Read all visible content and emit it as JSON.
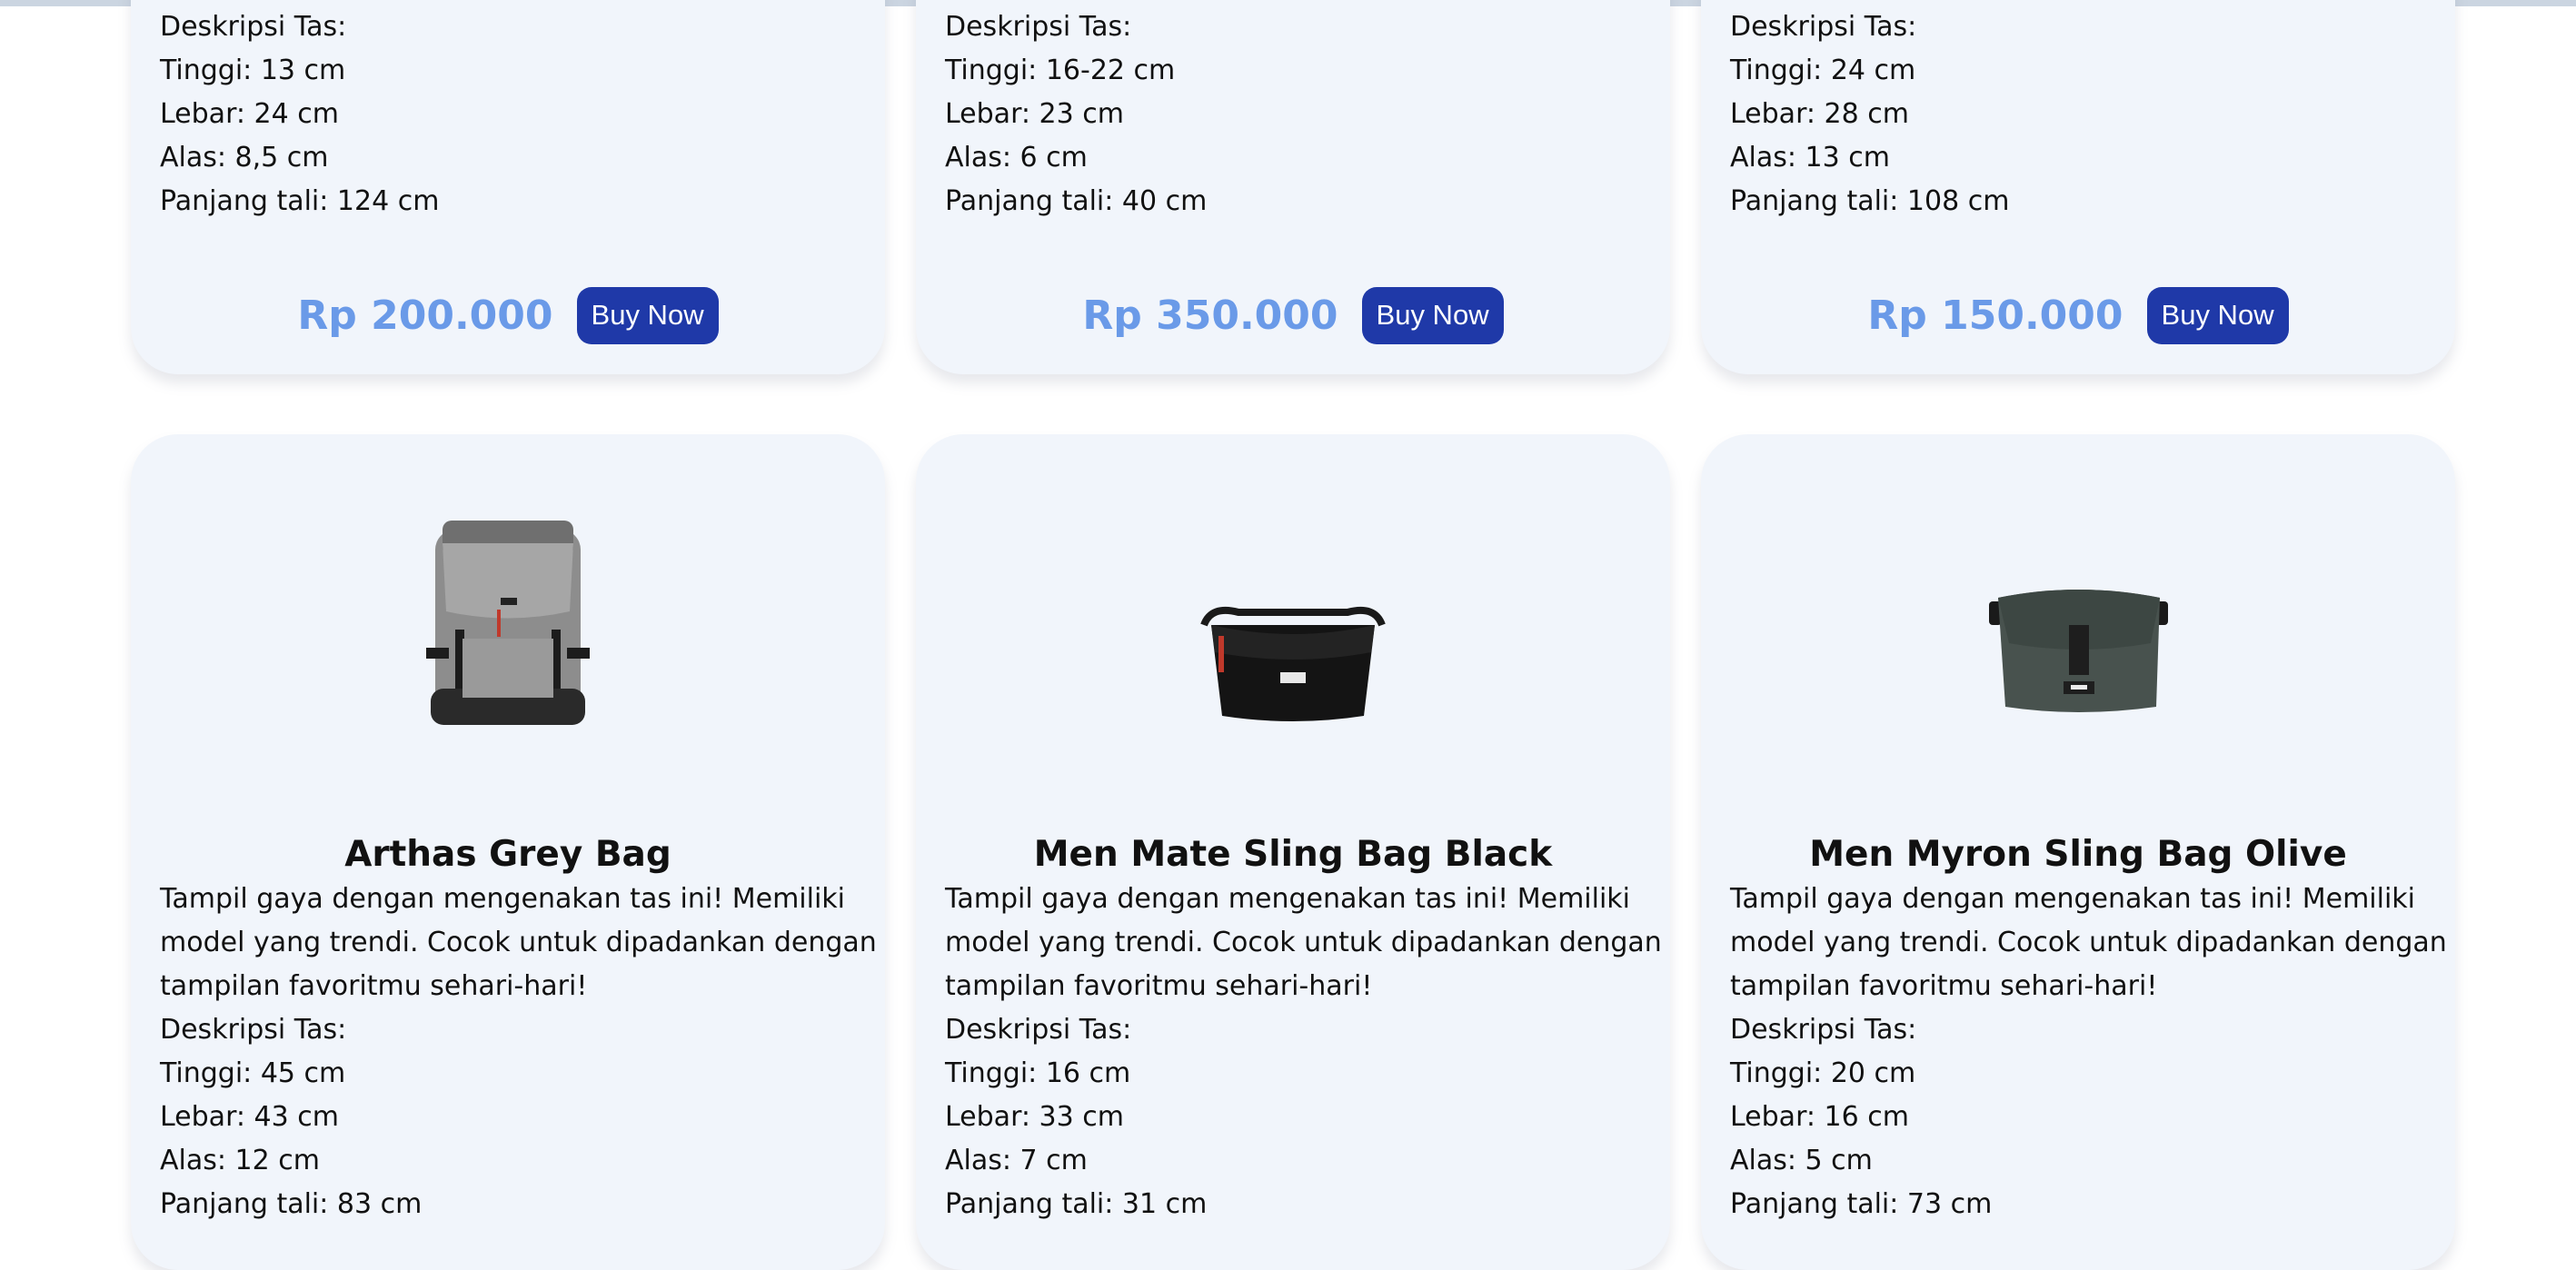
{
  "top_cards": [
    {
      "lines": [
        "Deskripsi Tas:",
        "Tinggi: 13 cm",
        "Lebar: 24 cm",
        "Alas: 8,5 cm",
        "Panjang tali: 124 cm"
      ],
      "price": "Rp 200.000",
      "button": "Buy Now"
    },
    {
      "lines": [
        "Deskripsi Tas:",
        "Tinggi: 16-22 cm",
        "Lebar: 23 cm",
        "Alas: 6 cm",
        "Panjang tali: 40 cm"
      ],
      "price": "Rp 350.000",
      "button": "Buy Now"
    },
    {
      "lines": [
        "Deskripsi Tas:",
        "Tinggi: 24 cm",
        "Lebar: 28 cm",
        "Alas: 13 cm",
        "Panjang tali: 108 cm"
      ],
      "price": "Rp 150.000",
      "button": "Buy Now"
    }
  ],
  "bottom_cards": [
    {
      "title": "Arthas Grey Bag",
      "image": "grey-backpack",
      "lines": [
        "Tampil gaya dengan mengenakan tas ini! Memiliki",
        "model yang trendi. Cocok untuk dipadankan dengan",
        "tampilan favoritmu sehari-hari!",
        "Deskripsi Tas:",
        "Tinggi: 45 cm",
        "Lebar: 43 cm",
        "Alas: 12 cm",
        "Panjang tali: 83 cm"
      ]
    },
    {
      "title": "Men Mate Sling Bag Black",
      "image": "black-sling-bag",
      "lines": [
        "Tampil gaya dengan mengenakan tas ini! Memiliki",
        "model yang trendi. Cocok untuk dipadankan dengan",
        "tampilan favoritmu sehari-hari!",
        "Deskripsi Tas:",
        "Tinggi: 16 cm",
        "Lebar: 33 cm",
        "Alas: 7 cm",
        "Panjang tali: 31 cm"
      ]
    },
    {
      "title": "Men Myron Sling Bag Olive",
      "image": "olive-sling-bag",
      "lines": [
        "Tampil gaya dengan mengenakan tas ini! Memiliki",
        "model yang trendi. Cocok untuk dipadankan dengan",
        "tampilan favoritmu sehari-hari!",
        "Deskripsi Tas:",
        "Tinggi: 20 cm",
        "Lebar: 16 cm",
        "Alas: 5 cm",
        "Panjang tali: 73 cm"
      ]
    }
  ],
  "colors": {
    "card_bg": "#f1f5fb",
    "price": "#6a9ae8",
    "button": "#1f39a8"
  }
}
